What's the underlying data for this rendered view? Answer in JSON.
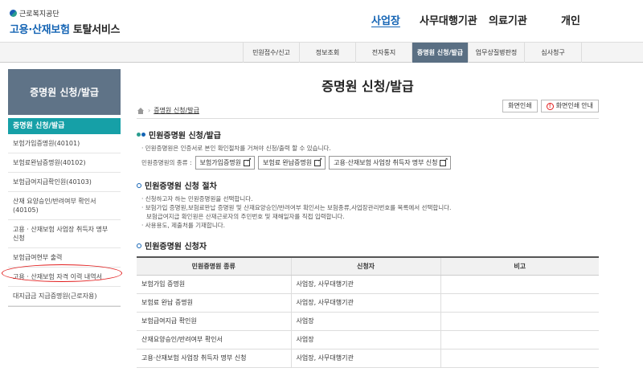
{
  "header": {
    "org": "근로복지공단",
    "title_blue": "고용·산재보험",
    "title_dark": "토탈서비스",
    "nav": [
      "사업장",
      "사무대행기관",
      "의료기관",
      "개인"
    ]
  },
  "subnav": [
    "민원접수/신고",
    "정보조회",
    "전자통지",
    "증명원 신청/발급",
    "업무상질병판정",
    "심사청구"
  ],
  "sidebar": {
    "heading": "증명원 신청/발급",
    "active": "증명원 신청/발급",
    "items": [
      "보험가입증명원(40101)",
      "보험료완납증명원(40102)",
      "보험급여지급확인원(40103)",
      "산재 요양승인/반려여부 확인서 (40105)",
      "고용 · 산재보험 사업장 취득자 명부 신청",
      "보험급여현부 출력",
      "고용 · 산재보험 자격 이력 내역서",
      "대지급금 지급증명원(근로자용)"
    ]
  },
  "main": {
    "title": "증명원 신청/발급",
    "breadcrumb": [
      "증명원 신청/발급"
    ],
    "print_label": "화면인쇄",
    "print_guide_label": "화면인쇄 안내",
    "sec1": {
      "title": "민원증명원 신청/발급",
      "desc": "민원증명원은 인증서로 본인 확인절차를 거쳐야 신청/출력 할 수 있습니다.",
      "kinds_label": "민원증명원의 종류 :",
      "kinds": [
        "보험가입증명원",
        "보험료 완납증명원",
        "고용·산재보험 사업장 취득자 명부 신청"
      ]
    },
    "sec2": {
      "title": "민원증명원 신청 절차",
      "lines": [
        "신청하고자 하는 민원증명원을 선택합니다.",
        "보험가입 증명원,보험료완납 증명원 및 산재요양승인/반려여부 확인서는 보험종류,사업장관리번호를 목록에서 선택합니다.",
        "보험급여지급 확인원은 산재근로자의 주민번호 및 재해일자를 직접 입력합니다.",
        "사용용도, 제출처를 기재합니다."
      ]
    },
    "sec3": {
      "title": "민원증명원 신청자",
      "headers": [
        "민원증명원 종류",
        "신청자",
        "비고"
      ],
      "rows": [
        [
          "보험가입 증명원",
          "사업장, 사무대행기관",
          ""
        ],
        [
          "보험료 완납 증명원",
          "사업장, 사무대행기관",
          ""
        ],
        [
          "보험급여지급 확인원",
          "사업장",
          ""
        ],
        [
          "산재요양승인/반려여부 확인서",
          "사업장",
          ""
        ],
        [
          "고용·산재보험 사업장 취득자 명부 신청",
          "사업장, 사무대행기관",
          ""
        ]
      ]
    }
  },
  "colors": {
    "brand_blue": "#1464b4",
    "side_active": "#16a0a7",
    "side_head": "#5f7387",
    "annotation_red": "#e21d1d"
  }
}
